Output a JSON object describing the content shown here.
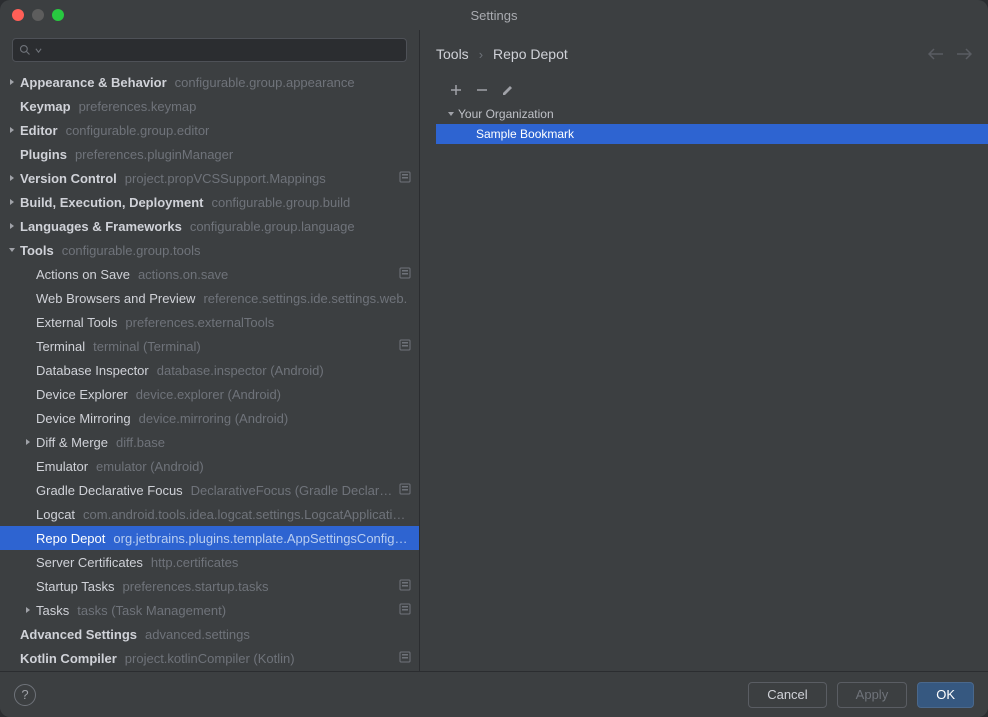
{
  "window_title": "Settings",
  "search": {
    "placeholder": ""
  },
  "sidebar": {
    "items": [
      {
        "label": "Appearance & Behavior",
        "hint": "configurable.group.appearance",
        "expandable": true,
        "indent": 0
      },
      {
        "label": "Keymap",
        "hint": "preferences.keymap",
        "expandable": false,
        "indent": 0
      },
      {
        "label": "Editor",
        "hint": "configurable.group.editor",
        "expandable": true,
        "indent": 0
      },
      {
        "label": "Plugins",
        "hint": "preferences.pluginManager",
        "expandable": false,
        "indent": 0
      },
      {
        "label": "Version Control",
        "hint": "project.propVCSSupport.Mappings",
        "expandable": true,
        "indent": 0,
        "badge": true
      },
      {
        "label": "Build, Execution, Deployment",
        "hint": "configurable.group.build",
        "expandable": true,
        "indent": 0
      },
      {
        "label": "Languages & Frameworks",
        "hint": "configurable.group.language",
        "expandable": true,
        "indent": 0
      },
      {
        "label": "Tools",
        "hint": "configurable.group.tools",
        "expandable": true,
        "expanded": true,
        "indent": 0
      },
      {
        "label": "Actions on Save",
        "hint": "actions.on.save",
        "expandable": false,
        "indent": 1,
        "child": true,
        "badge": true
      },
      {
        "label": "Web Browsers and Preview",
        "hint": "reference.settings.ide.settings.web.",
        "expandable": false,
        "indent": 1,
        "child": true
      },
      {
        "label": "External Tools",
        "hint": "preferences.externalTools",
        "expandable": false,
        "indent": 1,
        "child": true
      },
      {
        "label": "Terminal",
        "hint": "terminal (Terminal)",
        "expandable": false,
        "indent": 1,
        "child": true,
        "badge": true
      },
      {
        "label": "Database Inspector",
        "hint": "database.inspector (Android)",
        "expandable": false,
        "indent": 1,
        "child": true
      },
      {
        "label": "Device Explorer",
        "hint": "device.explorer (Android)",
        "expandable": false,
        "indent": 1,
        "child": true
      },
      {
        "label": "Device Mirroring",
        "hint": "device.mirroring (Android)",
        "expandable": false,
        "indent": 1,
        "child": true
      },
      {
        "label": "Diff & Merge",
        "hint": "diff.base",
        "expandable": true,
        "indent": 1,
        "child": true
      },
      {
        "label": "Emulator",
        "hint": "emulator (Android)",
        "expandable": false,
        "indent": 1,
        "child": true
      },
      {
        "label": "Gradle Declarative Focus",
        "hint": "DeclarativeFocus (Gradle Declarativ",
        "expandable": false,
        "indent": 1,
        "child": true,
        "badge": true
      },
      {
        "label": "Logcat",
        "hint": "com.android.tools.idea.logcat.settings.LogcatApplicationSe",
        "expandable": false,
        "indent": 1,
        "child": true
      },
      {
        "label": "Repo Depot",
        "hint": "org.jetbrains.plugins.template.AppSettingsConfigurat",
        "expandable": false,
        "indent": 1,
        "child": true,
        "selected": true
      },
      {
        "label": "Server Certificates",
        "hint": "http.certificates",
        "expandable": false,
        "indent": 1,
        "child": true
      },
      {
        "label": "Startup Tasks",
        "hint": "preferences.startup.tasks",
        "expandable": false,
        "indent": 1,
        "child": true,
        "badge": true
      },
      {
        "label": "Tasks",
        "hint": "tasks (Task Management)",
        "expandable": true,
        "indent": 1,
        "child": true,
        "badge": true
      },
      {
        "label": "Advanced Settings",
        "hint": "advanced.settings",
        "expandable": false,
        "indent": 0
      },
      {
        "label": "Kotlin Compiler",
        "hint": "project.kotlinCompiler (Kotlin)",
        "expandable": false,
        "indent": 0,
        "badge": true
      }
    ]
  },
  "breadcrumb": {
    "root": "Tools",
    "current": "Repo Depot"
  },
  "detail": {
    "group_label": "Your Organization",
    "item_label": "Sample Bookmark"
  },
  "buttons": {
    "cancel": "Cancel",
    "apply": "Apply",
    "ok": "OK"
  }
}
